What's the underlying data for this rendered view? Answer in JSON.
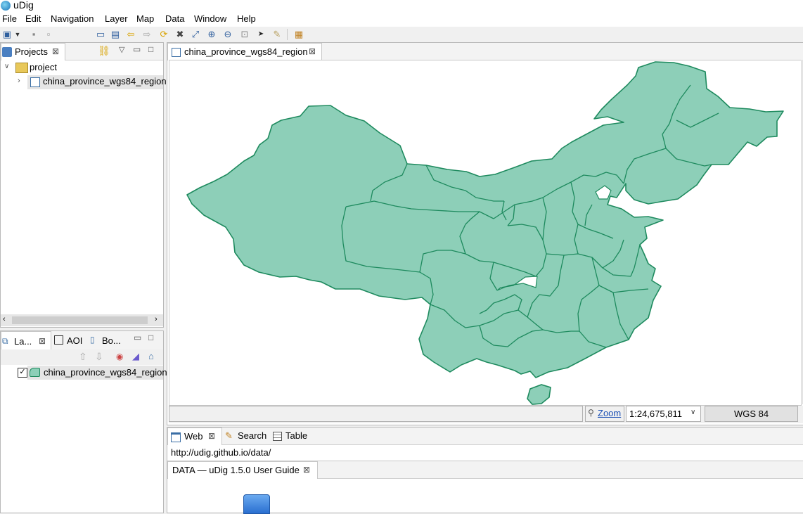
{
  "window": {
    "title": "uDig"
  },
  "menubar": {
    "items": [
      "File",
      "Edit",
      "Navigation",
      "Layer",
      "Map",
      "Data",
      "Window",
      "Help"
    ]
  },
  "projects_panel": {
    "tab_label": "Projects",
    "tree": {
      "project_label": "project",
      "map_label": "china_province_wgs84_region"
    }
  },
  "layers_panel": {
    "tabs": [
      "La...",
      "AOI",
      "Bo..."
    ],
    "layer": {
      "label": "china_province_wgs84_region",
      "checked": true
    }
  },
  "map_editor": {
    "tab_label": "china_province_wgs84_region",
    "fill_color": "#8dcfb8",
    "stroke_color": "#1e8a5e",
    "status": {
      "zoom_label": "Zoom",
      "scale": "1:24,675,811",
      "crs": "WGS 84"
    }
  },
  "bottom_panel": {
    "tabs": [
      "Web",
      "Search",
      "Table"
    ],
    "url": "http://udig.github.io/data/",
    "doc_tab_label": "DATA — uDig 1.5.0 User Guide"
  }
}
